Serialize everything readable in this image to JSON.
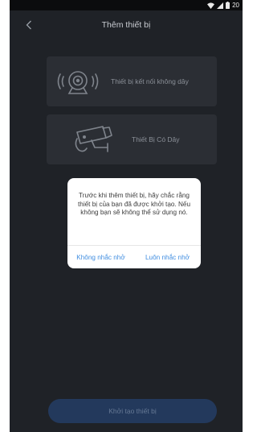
{
  "status_bar": {
    "time": "20",
    "icons": [
      "wifi-icon",
      "signal-icon",
      "battery-icon"
    ]
  },
  "header": {
    "title": "Thêm thiết bị",
    "back_icon": "chevron-left-icon"
  },
  "device_options": [
    {
      "label": "Thiết bị kết nối không dây",
      "icon": "wireless-camera-icon"
    },
    {
      "label": "Thiết Bị Có Dây",
      "icon": "wired-camera-icon"
    }
  ],
  "dialog": {
    "message": "Trước khi thêm thiết bị, hãy chắc rằng thiết bị của bạn đã được khởi tạo. Nếu không bạn sẽ không thể sử dụng nó.",
    "button_left": "Không nhắc nhở",
    "button_right": "Luôn nhắc nhở"
  },
  "footer": {
    "button_label": "Khởi tạo thiết bị"
  },
  "colors": {
    "background": "#1f2227",
    "card": "#2b2e34",
    "dialog_button": "#3f8de0",
    "footer_button": "#23395c"
  }
}
